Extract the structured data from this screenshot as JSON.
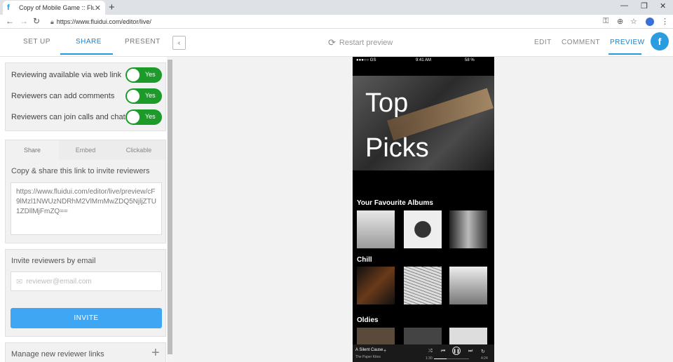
{
  "browser": {
    "tab_title": "Copy of Mobile Game :: Fluid UI",
    "url": "https://www.fluidui.com/editor/live/"
  },
  "header": {
    "left_tabs": [
      "SET UP",
      "SHARE",
      "PRESENT"
    ],
    "active_left_tab": "SHARE",
    "restart_label": "Restart preview",
    "right_tabs": [
      "EDIT",
      "COMMENT",
      "PREVIEW"
    ],
    "active_right_tab": "PREVIEW"
  },
  "settings": {
    "toggles": [
      {
        "label": "Reviewing available via web link",
        "value": "Yes"
      },
      {
        "label": "Reviewers can add comments",
        "value": "Yes"
      },
      {
        "label": "Reviewers can join calls and chat",
        "value": "Yes"
      }
    ]
  },
  "share": {
    "subtabs": [
      "Share",
      "Embed",
      "Clickable"
    ],
    "active_subtab": "Share",
    "copy_label": "Copy & share this link to invite reviewers",
    "link": "https://www.fluidui.com/editor/live/preview/cF9lMzl1NWUzNDRhM2VlMmMwZDQ5NjljZTU1ZDllMjFmZQ=="
  },
  "invite": {
    "label": "Invite reviewers by email",
    "placeholder": "reviewer@email.com",
    "button": "INVITE"
  },
  "manage": {
    "label": "Manage new reviewer links"
  },
  "phone": {
    "status_left": "●●●○○ GS",
    "status_time": "9:41 AM",
    "status_right": "58 %",
    "hero_line1": "Top",
    "hero_line2": "Picks",
    "sections": [
      "Your Favourite Albums",
      "Chill",
      "Oldies"
    ],
    "player": {
      "song": "A Silent Cause",
      "artist": "The Paper Kites",
      "time_elapsed": "1:30",
      "time_total": "4:24",
      "progress": 0.35
    }
  }
}
